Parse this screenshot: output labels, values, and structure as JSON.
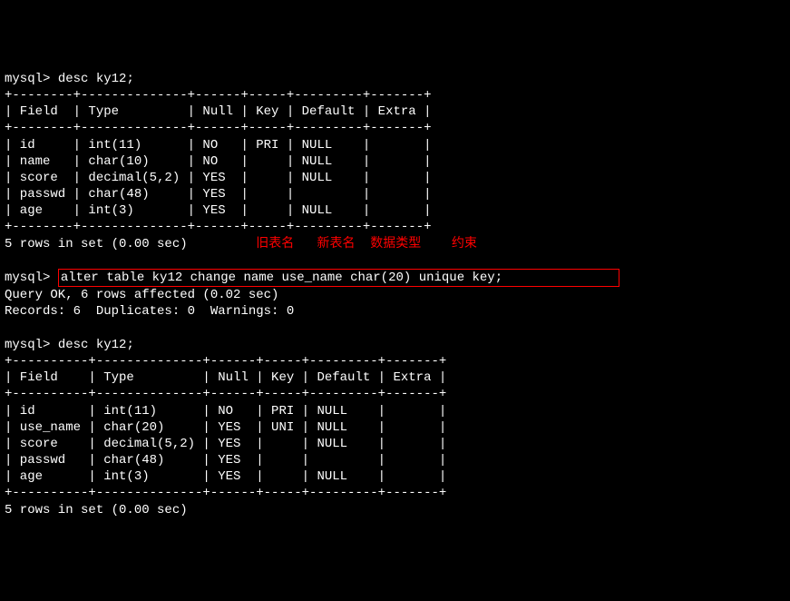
{
  "prompt": "mysql>",
  "commands": {
    "desc1": "desc ky12;",
    "alter": "alter table ky12 change name use_name char(20) unique key;",
    "desc2": "desc ky12;"
  },
  "table1": {
    "sep": "+--------+--------------+------+-----+---------+-------+",
    "header": "| Field  | Type         | Null | Key | Default | Extra |",
    "rows": [
      "| id     | int(11)      | NO   | PRI | NULL    |       |",
      "| name   | char(10)     | NO   |     | NULL    |       |",
      "| score  | decimal(5,2) | YES  |     | NULL    |       |",
      "| passwd | char(48)     | YES  |     |         |       |",
      "| age    | int(3)       | YES  |     | NULL    |       |"
    ],
    "footer": "5 rows in set (0.00 sec)"
  },
  "annotations": {
    "old_name": "旧表名",
    "new_name": "新表名",
    "data_type": "数据类型",
    "constraint": "约束"
  },
  "alter_result": {
    "line1": "Query OK, 6 rows affected (0.02 sec)",
    "line2": "Records: 6  Duplicates: 0  Warnings: 0"
  },
  "table2": {
    "sep": "+----------+--------------+------+-----+---------+-------+",
    "header": "| Field    | Type         | Null | Key | Default | Extra |",
    "rows": [
      "| id       | int(11)      | NO   | PRI | NULL    |       |",
      "| use_name | char(20)     | YES  | UNI | NULL    |       |",
      "| score    | decimal(5,2) | YES  |     | NULL    |       |",
      "| passwd   | char(48)     | YES  |     |         |       |",
      "| age      | int(3)       | YES  |     | NULL    |       |"
    ],
    "footer": "5 rows in set (0.00 sec)"
  }
}
